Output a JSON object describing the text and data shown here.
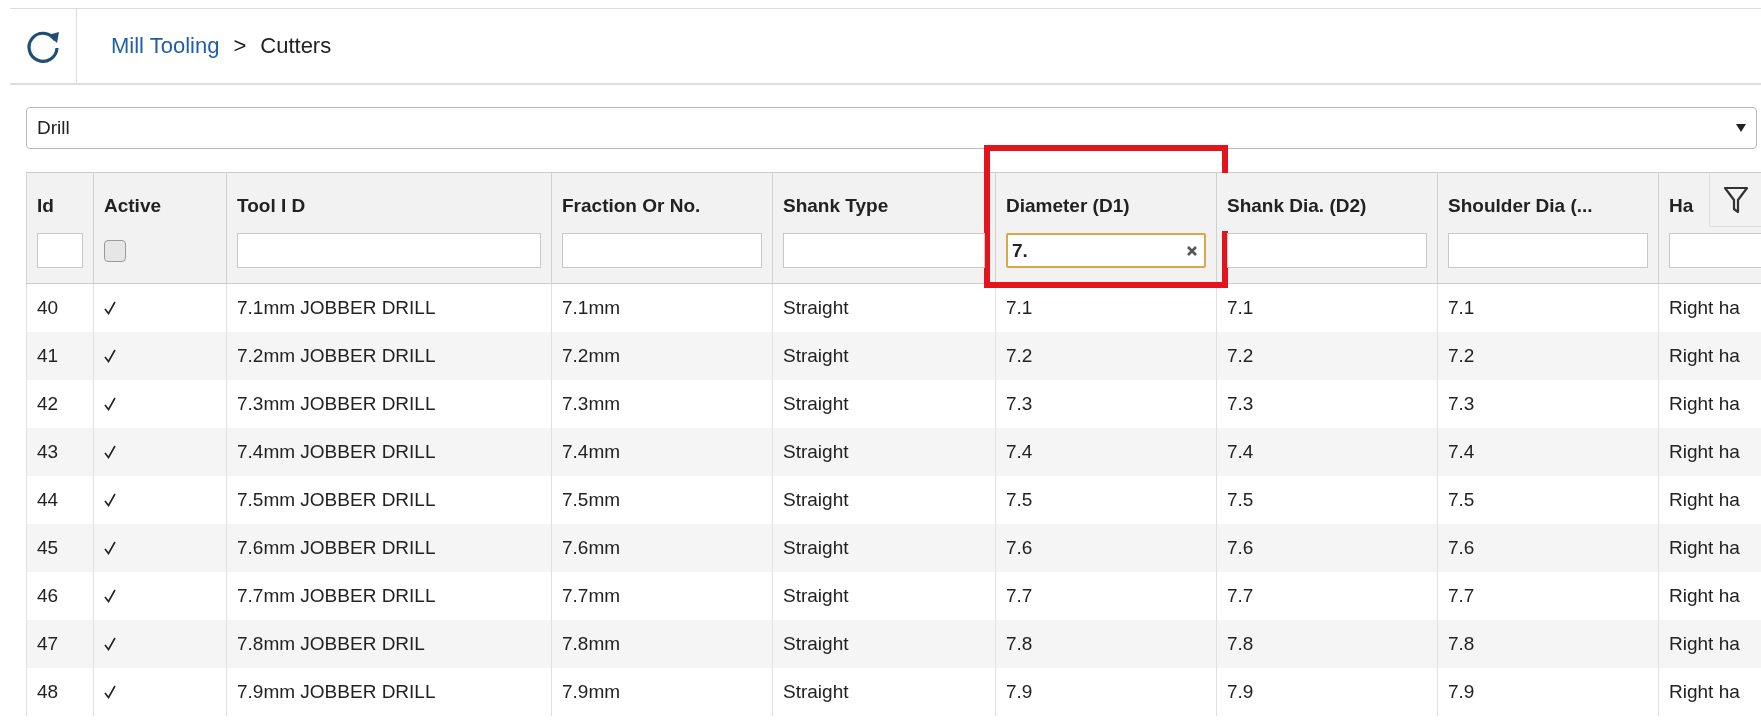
{
  "breadcrumb": [
    {
      "label": "Mill Tooling",
      "kind": "link"
    },
    {
      "label": ">",
      "kind": "separator"
    },
    {
      "label": "Cutters",
      "kind": "current"
    }
  ],
  "category_select": {
    "value": "Drill"
  },
  "table": {
    "columns": [
      {
        "label": "Id",
        "kind": "text",
        "focused": false,
        "highlighted": false
      },
      {
        "label": "Active",
        "kind": "checkbox",
        "checked": false,
        "highlighted": false
      },
      {
        "label": "Tool I D",
        "kind": "text",
        "focused": false,
        "highlighted": false
      },
      {
        "label": "Fraction Or No.",
        "kind": "text",
        "focused": false,
        "highlighted": false
      },
      {
        "label": "Shank Type",
        "kind": "text",
        "focused": false,
        "highlighted": false
      },
      {
        "label": "Diameter (D1)",
        "kind": "text",
        "filter_value": "7.",
        "focused": true,
        "highlighted": true
      },
      {
        "label": "Shank Dia. (D2)",
        "kind": "text",
        "focused": false,
        "highlighted": false
      },
      {
        "label": "Shoulder Dia (...",
        "kind": "text",
        "focused": false,
        "highlighted": false
      },
      {
        "label": "Ha",
        "kind": "text",
        "focused": false,
        "highlighted": false
      }
    ],
    "rows": [
      {
        "active": true,
        "cells": [
          "40",
          "",
          "7.1mm JOBBER DRILL",
          "7.1mm",
          "Straight",
          "7.1",
          "7.1",
          "7.1",
          "Right ha"
        ]
      },
      {
        "active": true,
        "cells": [
          "41",
          "",
          "7.2mm JOBBER DRILL",
          "7.2mm",
          "Straight",
          "7.2",
          "7.2",
          "7.2",
          "Right ha"
        ]
      },
      {
        "active": true,
        "cells": [
          "42",
          "",
          "7.3mm JOBBER DRILL",
          "7.3mm",
          "Straight",
          "7.3",
          "7.3",
          "7.3",
          "Right ha"
        ]
      },
      {
        "active": true,
        "cells": [
          "43",
          "",
          "7.4mm JOBBER DRILL",
          "7.4mm",
          "Straight",
          "7.4",
          "7.4",
          "7.4",
          "Right ha"
        ]
      },
      {
        "active": true,
        "cells": [
          "44",
          "",
          "7.5mm JOBBER DRILL",
          "7.5mm",
          "Straight",
          "7.5",
          "7.5",
          "7.5",
          "Right ha"
        ]
      },
      {
        "active": true,
        "cells": [
          "45",
          "",
          "7.6mm JOBBER DRILL",
          "7.6mm",
          "Straight",
          "7.6",
          "7.6",
          "7.6",
          "Right ha"
        ]
      },
      {
        "active": true,
        "cells": [
          "46",
          "",
          "7.7mm JOBBER DRILL",
          "7.7mm",
          "Straight",
          "7.7",
          "7.7",
          "7.7",
          "Right ha"
        ]
      },
      {
        "active": true,
        "cells": [
          "47",
          "",
          "7.8mm JOBBER DRIL",
          "7.8mm",
          "Straight",
          "7.8",
          "7.8",
          "7.8",
          "Right ha"
        ]
      },
      {
        "active": true,
        "cells": [
          "48",
          "",
          "7.9mm JOBBER DRILL",
          "7.9mm",
          "Straight",
          "7.9",
          "7.9",
          "7.9",
          "Right ha"
        ]
      }
    ]
  }
}
